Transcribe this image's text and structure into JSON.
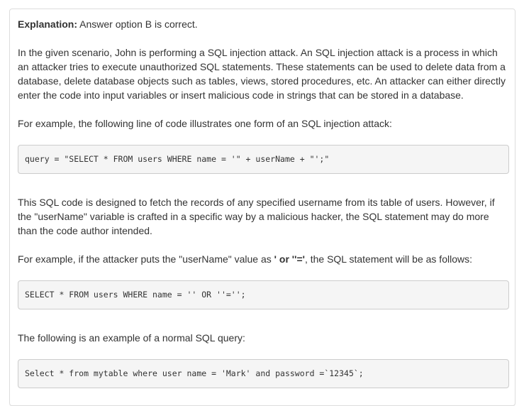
{
  "explanation": {
    "label": "Explanation:",
    "answer": " Answer option B is correct."
  },
  "paragraphs": {
    "scenario": "In the given scenario, John is performing a SQL injection attack. An SQL injection attack is a process in which an attacker tries to execute unauthorized SQL statements. These statements can be used to delete data from a database, delete database objects such as tables, views, stored procedures, etc. An attacker can either directly enter the code into input variables or insert malicious code in strings that can be stored in a database.",
    "example_intro": "For example, the following line of code illustrates one form of an SQL injection attack:",
    "designed": "This SQL code is designed to fetch the records of any specified username from its table of users. However, if the \"userName\" variable is crafted in a specific way by a malicious hacker, the SQL statement may do more than the code author intended.",
    "attacker_prefix": "For example, if the attacker puts the \"userName\" value as ",
    "attacker_value": "' or ''='",
    "attacker_suffix": ", the SQL statement will be as follows:",
    "normal_intro": "The following is an example of a normal SQL query:"
  },
  "code": {
    "injection": "query = \"SELECT * FROM users WHERE name = '\" + userName + \"';\"",
    "result": "SELECT * FROM users WHERE name = '' OR ''='';",
    "normal": "Select * from mytable where user name = 'Mark' and password =`12345`;"
  }
}
